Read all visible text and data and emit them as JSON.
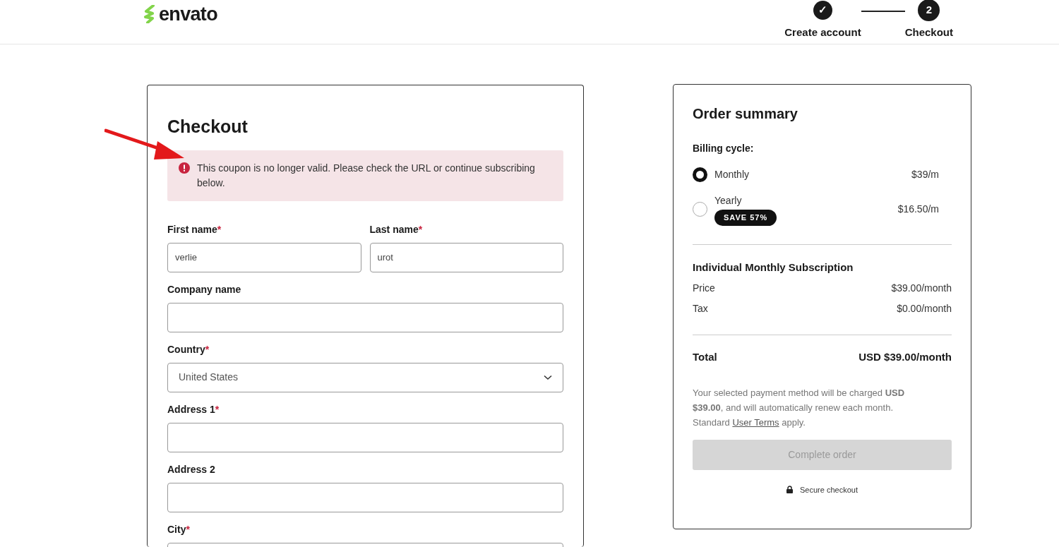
{
  "header": {
    "logo": "envato",
    "steps": [
      {
        "label": "Create account",
        "marker": "✓",
        "done": true
      },
      {
        "label": "Checkout",
        "marker": "2",
        "done": false
      }
    ]
  },
  "checkout": {
    "title": "Checkout",
    "alert": {
      "text": "This coupon is no longer valid. Please check the URL or continue subscribing below."
    },
    "rows": [
      [
        {
          "label": "First name",
          "required_mark": "*",
          "kind": "text",
          "value": "verlie"
        },
        {
          "label": "Last name",
          "required_mark": "*",
          "kind": "text",
          "value": "urot"
        }
      ],
      [
        {
          "label": "Company name",
          "kind": "text"
        }
      ],
      [
        {
          "label": "Country",
          "required_mark": "*",
          "kind": "select",
          "value": "United States"
        }
      ],
      [
        {
          "label": "Address 1",
          "required_mark": "*",
          "kind": "text"
        }
      ],
      [
        {
          "label": "Address 2",
          "kind": "text"
        }
      ],
      [
        {
          "label": "City",
          "required_mark": "*",
          "kind": "text"
        }
      ]
    ]
  },
  "order_summary": {
    "title": "Order summary",
    "billing_label": "Billing cycle:",
    "options": [
      {
        "label": "Monthly",
        "price": "$39/m",
        "selected": true
      },
      {
        "label": "Yearly",
        "badge": "SAVE 57%",
        "price": "$16.50/m",
        "selected": false
      }
    ],
    "plan": "Individual Monthly Subscription",
    "lines": [
      {
        "label": "Price",
        "amount": "$39.00/month"
      },
      {
        "label": "Tax",
        "amount": "$0.00/month"
      }
    ],
    "total": {
      "label": "Total",
      "amount": "USD $39.00/month"
    },
    "note": {
      "before": "Your selected payment method will be charged **USD $39.00**, and will automatically renew each month. Standard ",
      "link": "User Terms",
      "after": " apply."
    },
    "button": {
      "label": "Complete order",
      "disabled": true
    },
    "secure": "Secure checkout"
  }
}
